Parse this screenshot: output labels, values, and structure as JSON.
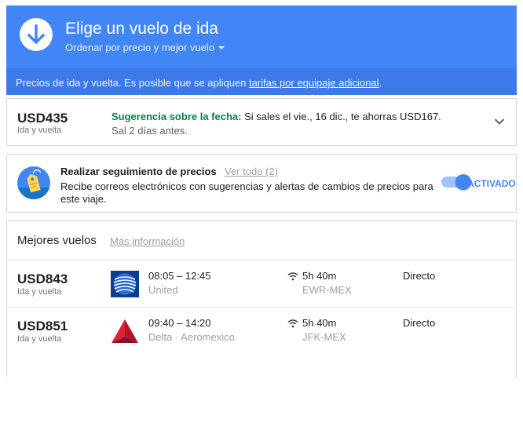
{
  "header": {
    "title": "Elige un vuelo de ida",
    "sort_label": "Ordenar por precio y mejor vuelo",
    "notice_text": "Precios de ida y vuelta. Es posible que se apliquen ",
    "notice_link": "tarifas por equipaje adicional",
    "notice_end": "."
  },
  "tip": {
    "price": "USD435",
    "price_sub": "Ida y vuelta",
    "highlight": "Sugerencia sobre la fecha:",
    "text": " Si sales el vie., 16 dic., te ahorras USD167.",
    "line2": "Sal 2 días antes."
  },
  "tracking": {
    "title": "Realizar seguimiento de precios",
    "link": "Ver todo (2)",
    "description": "Recibe correos electrónicos con sugerencias y alertas de cambios de precios para este viaje.",
    "toggle_label": "ACTIVADO",
    "toggle_on": true
  },
  "best_flights": {
    "title": "Mejores vuelos",
    "link": "Más información",
    "flights": [
      {
        "price": "USD843",
        "price_sub": "Ida y vuelta",
        "logo_icon": "united-logo-icon",
        "times": "08:05 – 12:45",
        "airline": "United",
        "duration": "5h 40m",
        "route": "EWR-MEX",
        "stops": "Directo"
      },
      {
        "price": "USD851",
        "price_sub": "Ida y vuelta",
        "logo_icon": "delta-logo-icon",
        "times": "09:40 – 14:20",
        "airline": "Delta · Aeromexico",
        "duration": "5h 40m",
        "route": "JFK-MEX",
        "stops": "Directo"
      }
    ]
  },
  "colors": {
    "primary": "#4285f4",
    "header_bar": "#3b7ae8",
    "suggestion_green": "#0b8043",
    "muted_text": "#9e9e9e"
  }
}
